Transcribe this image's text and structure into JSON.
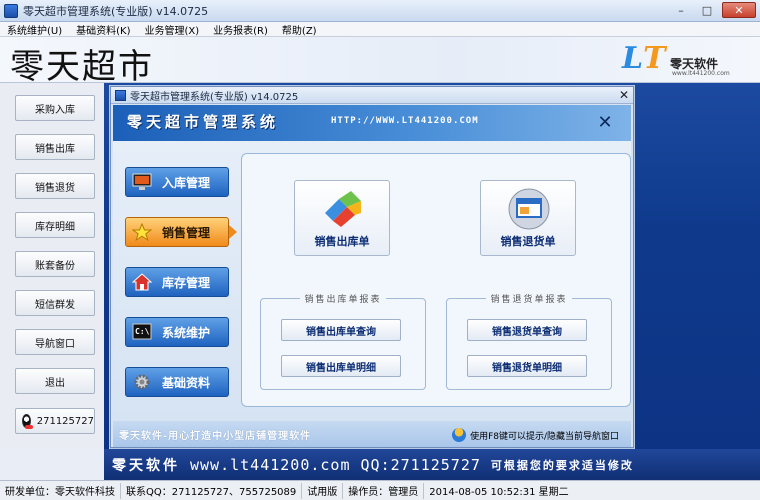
{
  "window": {
    "title": "零天超市管理系统(专业版) v14.0725",
    "controls": [
      "–",
      "□",
      "✕"
    ]
  },
  "menu": [
    "系统维护(U)",
    "基础资料(K)",
    "业务管理(X)",
    "业务报表(R)",
    "帮助(Z)"
  ],
  "header": {
    "title": "零天超市",
    "logo_name": "零天软件",
    "logo_url": "www.lt441200.com"
  },
  "sidebar": {
    "buttons": [
      "采购入库",
      "销售出库",
      "销售退货",
      "库存明细",
      "账套备份",
      "短信群发",
      "导航窗口",
      "退出"
    ],
    "qq": "271125727"
  },
  "dialog": {
    "title": "零天超市管理系统(专业版) v14.0725",
    "system_name": "零天超市管理系统",
    "url": "HTTP://WWW.LT441200.COM",
    "nav": [
      "入库管理",
      "销售管理",
      "库存管理",
      "系统维护",
      "基础资料"
    ],
    "active_nav": 1,
    "big_buttons": [
      "销售出库单",
      "销售退货单"
    ],
    "group_left": {
      "title": "销售出库单报表",
      "buttons": [
        "销售出库单查询",
        "销售出库单明细"
      ]
    },
    "group_right": {
      "title": "销售退货单报表",
      "buttons": [
        "销售退货单查询",
        "销售退货单明细"
      ]
    },
    "slogan": "零天软件-用心打造中小型店铺管理软件",
    "hint": "使用F8键可以提示/隐藏当前导航窗口"
  },
  "banner": {
    "brand": "零天软件",
    "contact": "www.lt441200.com QQ:271125727",
    "tagline": "可根据您的要求适当修改"
  },
  "status": [
    "研发单位：零天软件科技",
    "联系QQ：271125727、755725089",
    "试用版",
    "操作员：管理员",
    "2014-08-05 10:52:31 星期二"
  ],
  "colors": {
    "accent_blue": "#1f63c0",
    "active_orange": "#f08a1a",
    "banner_blue": "#102f74"
  }
}
